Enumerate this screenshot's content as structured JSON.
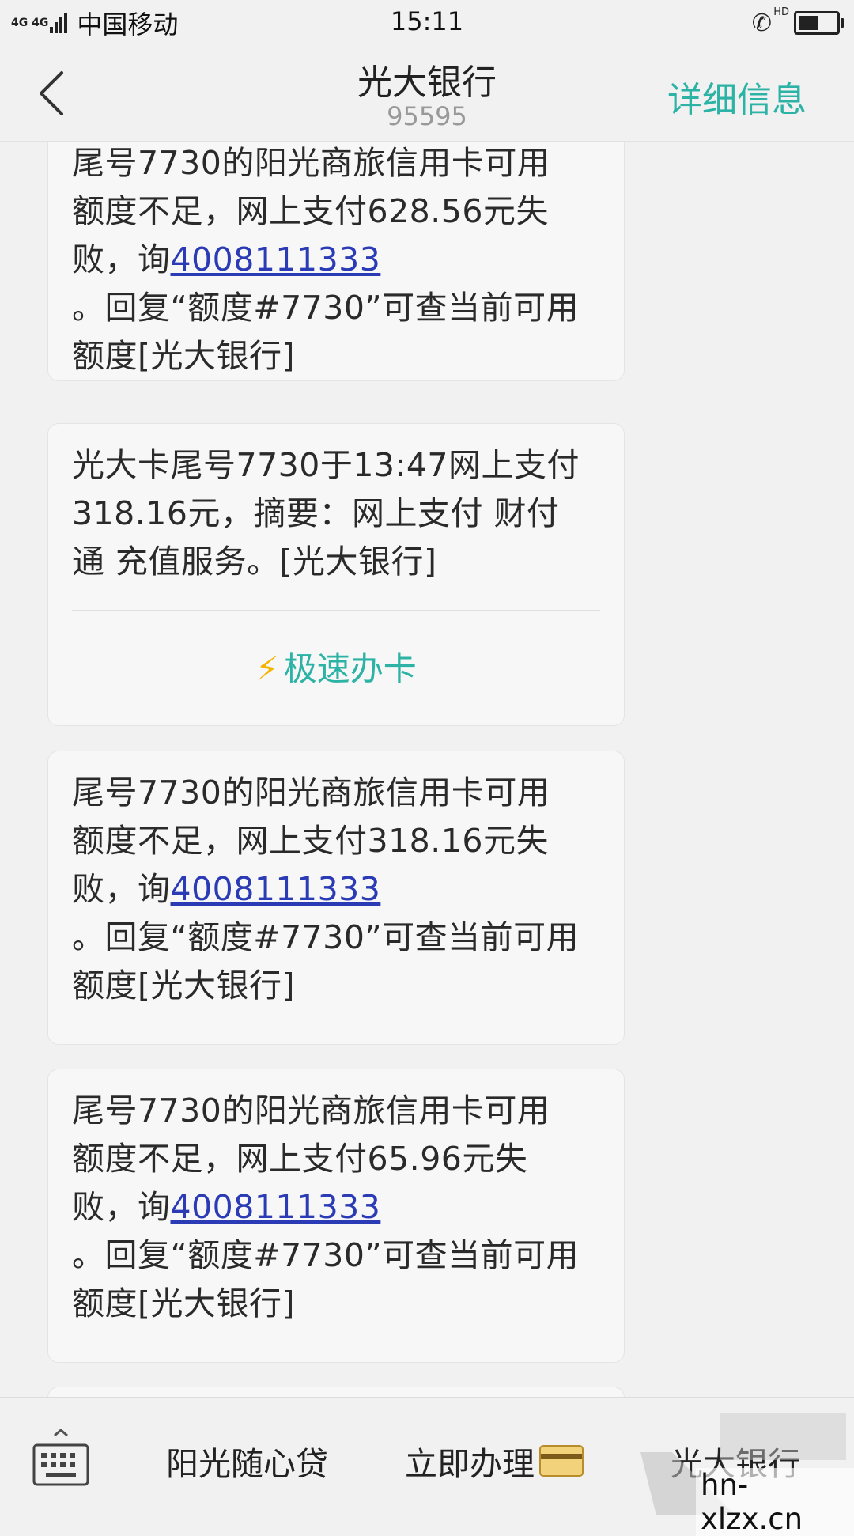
{
  "status_bar": {
    "network": "4G 4G",
    "carrier": "中国移动",
    "time": "15:11",
    "call_label": "HD",
    "battery_level": 0.55
  },
  "header": {
    "title": "光大银行",
    "number": "95595",
    "details_label": "详细信息"
  },
  "messages": [
    {
      "lines": [
        "尾号7730的阳光商旅信用卡可用",
        "额度不足，网上支付628.56元失",
        "败，询"
      ],
      "phone": "4008111333",
      "lines_after": [
        "。回复“额度#7730”可查当前可用",
        "额度[光大银行]"
      ]
    },
    {
      "lines": [
        "光大卡尾号7730于13:47网上支付",
        "318.16元，摘要：网上支付 财付",
        "通 充值服务。[光大银行]"
      ],
      "action_label": "极速办卡"
    },
    {
      "lines": [
        "尾号7730的阳光商旅信用卡可用",
        "额度不足，网上支付318.16元失",
        "败，询"
      ],
      "phone": "4008111333",
      "lines_after": [
        "。回复“额度#7730”可查当前可用",
        "额度[光大银行]"
      ]
    },
    {
      "lines": [
        "尾号7730的阳光商旅信用卡可用",
        "额度不足，网上支付65.96元失",
        "败，询"
      ],
      "phone": "4008111333",
      "lines_after": [
        "。回复“额度#7730”可查当前可用",
        "额度[光大银行]"
      ]
    }
  ],
  "bottom_bar": {
    "menu": [
      "阳光随心贷",
      "立即办理",
      "光大银行"
    ]
  },
  "watermark": {
    "text": "hn-xlzx.cn"
  },
  "colors": {
    "accent": "#2cb3a5",
    "link": "#2b3bb5",
    "background": "#f1f1f1"
  }
}
